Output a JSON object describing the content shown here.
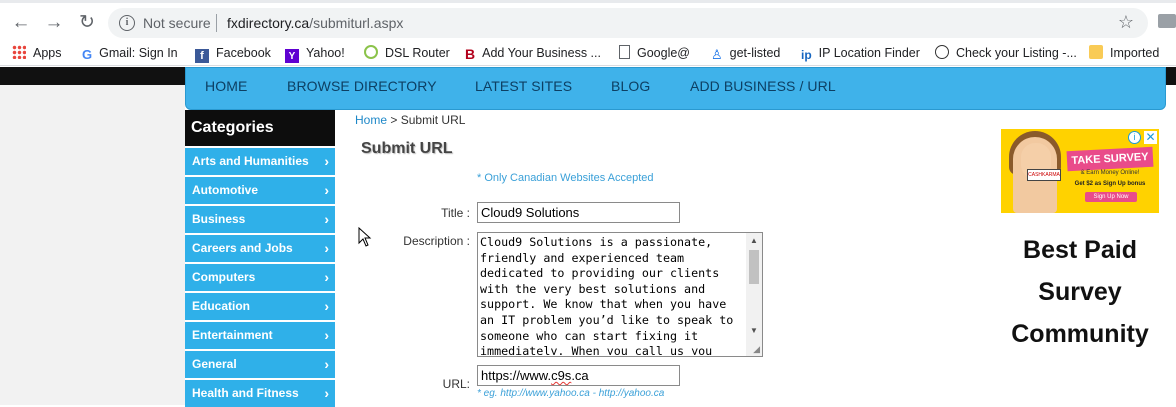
{
  "browser": {
    "security_label": "Not secure",
    "url_host": "fxdirectory.ca",
    "url_path": "/submiturl.aspx",
    "bookmarks": [
      {
        "label": "Apps",
        "icon": "apps-grid-icon"
      },
      {
        "label": "Gmail: Sign In",
        "icon": "google-icon"
      },
      {
        "label": "Facebook",
        "icon": "facebook-icon"
      },
      {
        "label": "Yahoo!",
        "icon": "yahoo-icon"
      },
      {
        "label": "DSL Router",
        "icon": "router-icon"
      },
      {
        "label": "Add Your Business ...",
        "icon": "bold-b-icon"
      },
      {
        "label": "Google@",
        "icon": "page-icon"
      },
      {
        "label": "get-listed",
        "icon": "person-icon"
      },
      {
        "label": "IP Location Finder",
        "icon": "ip-icon"
      },
      {
        "label": "Check your Listing -...",
        "icon": "circle-icon"
      },
      {
        "label": "Imported",
        "icon": "folder-icon"
      }
    ]
  },
  "nav": {
    "items": [
      "HOME",
      "BROWSE DIRECTORY",
      "LATEST SITES",
      "BLOG",
      "ADD BUSINESS / URL"
    ]
  },
  "sidebar": {
    "heading": "Categories",
    "items": [
      "Arts and Humanities",
      "Automotive",
      "Business",
      "Careers and Jobs",
      "Computers",
      "Education",
      "Entertainment",
      "General",
      "Health and Fitness"
    ]
  },
  "breadcrumb": {
    "home": "Home",
    "separator": ">",
    "current": "Submit URL"
  },
  "form": {
    "title": "Submit URL",
    "note": "* Only Canadian Websites Accepted",
    "title_label": "Title :",
    "title_value": "Cloud9 Solutions",
    "description_label": "Description :",
    "description_value": "Cloud9 Solutions is a passionate, friendly and experienced team dedicated to providing our clients with the very best solutions and support. We know that when you have an IT problem you’d like to speak to someone who can start fixing it immediately. When you call us you",
    "url_label": "URL:",
    "url_value_prefix": "https://www.",
    "url_value_misspelled": "c9s",
    "url_value_suffix": ".ca",
    "url_hint": "* eg. http://www.yahoo.ca - http://yahoo.ca"
  },
  "ad": {
    "take_survey": "TAKE SURVEY",
    "earn_money": "& Earn Money Online!",
    "bonus": "Get $2 as Sign Up bonus",
    "signup": "Sign Up Now",
    "phone_brand": "CASHKARMA",
    "headline": "Best Paid Survey Community",
    "colors": {
      "banner": "#ffd200",
      "accent": "#e94b8a"
    }
  },
  "colors": {
    "nav_bar": "#3fb2ea",
    "category_item": "#2fb0e9",
    "category_header": "#0d0d0d",
    "link": "#1e88c8"
  }
}
